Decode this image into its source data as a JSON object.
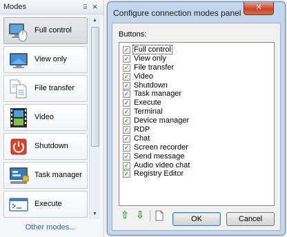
{
  "modes_panel": {
    "title": "Modes",
    "pin_glyph": "⍓",
    "close_glyph": "✕",
    "items": [
      {
        "label": "Full control",
        "icon": "mouse-monitor-icon",
        "selected": true
      },
      {
        "label": "View only",
        "icon": "monitor-icon",
        "selected": false
      },
      {
        "label": "File transfer",
        "icon": "file-transfer-icon",
        "selected": false
      },
      {
        "label": "Video",
        "icon": "film-icon",
        "selected": false
      },
      {
        "label": "Shutdown",
        "icon": "power-icon",
        "selected": false
      },
      {
        "label": "Task manager",
        "icon": "task-manager-icon",
        "selected": false
      },
      {
        "label": "Execute",
        "icon": "execute-icon",
        "selected": false
      }
    ],
    "other_modes_link": "Other modes...",
    "scroll_up_glyph": "▲",
    "scroll_down_glyph": "▼"
  },
  "dialog": {
    "title": "Configure connection modes panel",
    "close_glyph": "✕",
    "buttons_label": "Buttons:",
    "check_glyph": "✓",
    "items": [
      {
        "label": "Full control",
        "checked": true
      },
      {
        "label": "View only",
        "checked": true
      },
      {
        "label": "File transfer",
        "checked": true
      },
      {
        "label": "Video",
        "checked": true
      },
      {
        "label": "Shutdown",
        "checked": true
      },
      {
        "label": "Task manager",
        "checked": true
      },
      {
        "label": "Execute",
        "checked": true
      },
      {
        "label": "Terminal",
        "checked": true
      },
      {
        "label": "Device manager",
        "checked": true
      },
      {
        "label": "RDP",
        "checked": true
      },
      {
        "label": "Chat",
        "checked": true
      },
      {
        "label": "Screen recorder",
        "checked": true
      },
      {
        "label": "Send message",
        "checked": true
      },
      {
        "label": "Audio video chat",
        "checked": true
      },
      {
        "label": "Registry Editor",
        "checked": true
      }
    ],
    "toolbar": {
      "move_up_glyph": "⇧",
      "move_down_glyph": "⇩"
    },
    "ok_label": "OK",
    "cancel_label": "Cancel"
  },
  "colors": {
    "dialog_frame": "#c2d6ec",
    "close_button": "#c7442a",
    "link": "#1f5fbf",
    "arrow_green": "#3aa12e"
  }
}
